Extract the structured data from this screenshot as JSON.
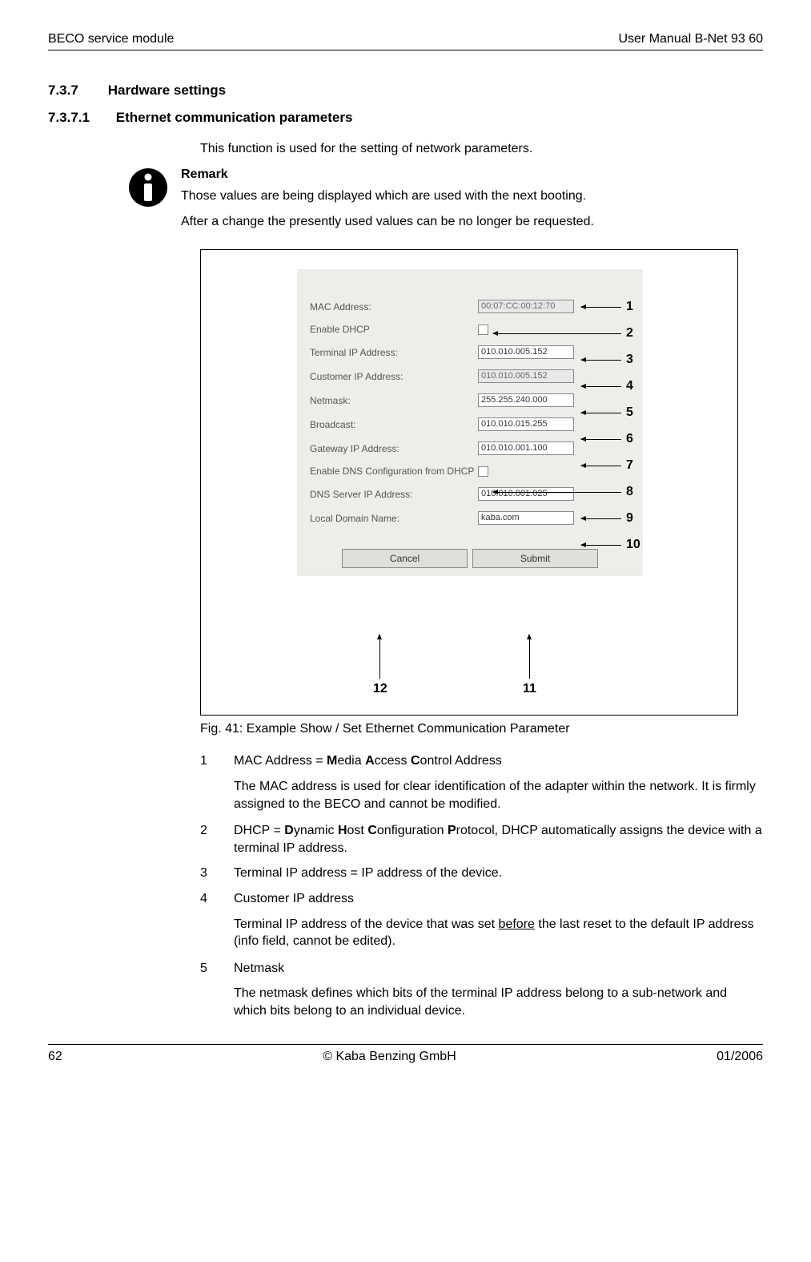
{
  "header": {
    "left": "BECO service module",
    "right": "User Manual B-Net 93 60"
  },
  "section": {
    "number": "7.3.7",
    "title": "Hardware settings"
  },
  "subsection": {
    "number": "7.3.7.1",
    "title": "Ethernet communication parameters"
  },
  "intro": "This function is used for the setting of network parameters.",
  "remark": {
    "title": "Remark",
    "line1": "Those values are being displayed which are used with the next booting.",
    "line2": "After a change the presently used values can be no longer be requested."
  },
  "form": {
    "fields": [
      {
        "label": "MAC Address:",
        "value": "00:07:CC:00:12:70",
        "type": "input-disabled",
        "num": "1"
      },
      {
        "label": "Enable DHCP",
        "value": "",
        "type": "checkbox",
        "num": "2"
      },
      {
        "label": "Terminal IP Address:",
        "value": "010.010.005.152",
        "type": "input",
        "num": "3"
      },
      {
        "label": "Customer IP Address:",
        "value": "010.010.005.152",
        "type": "input-disabled",
        "num": "4"
      },
      {
        "label": "Netmask:",
        "value": "255.255.240.000",
        "type": "input",
        "num": "5"
      },
      {
        "label": "Broadcast:",
        "value": "010.010.015.255",
        "type": "input",
        "num": "6"
      },
      {
        "label": "Gateway IP Address:",
        "value": "010.010.001.100",
        "type": "input",
        "num": "7"
      },
      {
        "label": "Enable DNS Configuration from DHCP",
        "value": "",
        "type": "checkbox",
        "num": "8"
      },
      {
        "label": "DNS Server IP Address:",
        "value": "010.010.001.025",
        "type": "input",
        "num": "9"
      },
      {
        "label": "Local Domain Name:",
        "value": "kaba.com",
        "type": "input",
        "num": "10"
      }
    ],
    "buttons": {
      "cancel": "Cancel",
      "submit": "Submit",
      "cancel_num": "12",
      "submit_num": "11"
    }
  },
  "caption": "Fig. 41: Example Show / Set Ethernet Communication Parameter",
  "items": [
    {
      "num": "1",
      "title_parts": [
        "MAC Address = ",
        "M",
        "edia ",
        "A",
        "ccess ",
        "C",
        "ontrol Address"
      ],
      "desc": "The MAC address is used for clear identification of the adapter within the network. It is firmly assigned to the BECO and cannot be modified."
    },
    {
      "num": "2",
      "title_parts": [
        "DHCP = ",
        "D",
        "ynamic ",
        "H",
        "ost ",
        "C",
        "onfiguration ",
        "P",
        "rotocol, DHCP automatically assigns the device with a terminal IP address."
      ],
      "desc": ""
    },
    {
      "num": "3",
      "title_plain": "Terminal IP address = IP address of the device.",
      "desc": ""
    },
    {
      "num": "4",
      "title_plain": "Customer IP address",
      "desc_html": "Terminal IP address of the device that was set <u>before</u> the last reset to the default IP address (info field, cannot be edited)."
    },
    {
      "num": "5",
      "title_plain": "Netmask",
      "desc": "The netmask defines which bits of the terminal IP address belong to a sub-network and which bits belong to an individual device."
    }
  ],
  "footer": {
    "left": "62",
    "center": "© Kaba Benzing GmbH",
    "right": "01/2006"
  }
}
